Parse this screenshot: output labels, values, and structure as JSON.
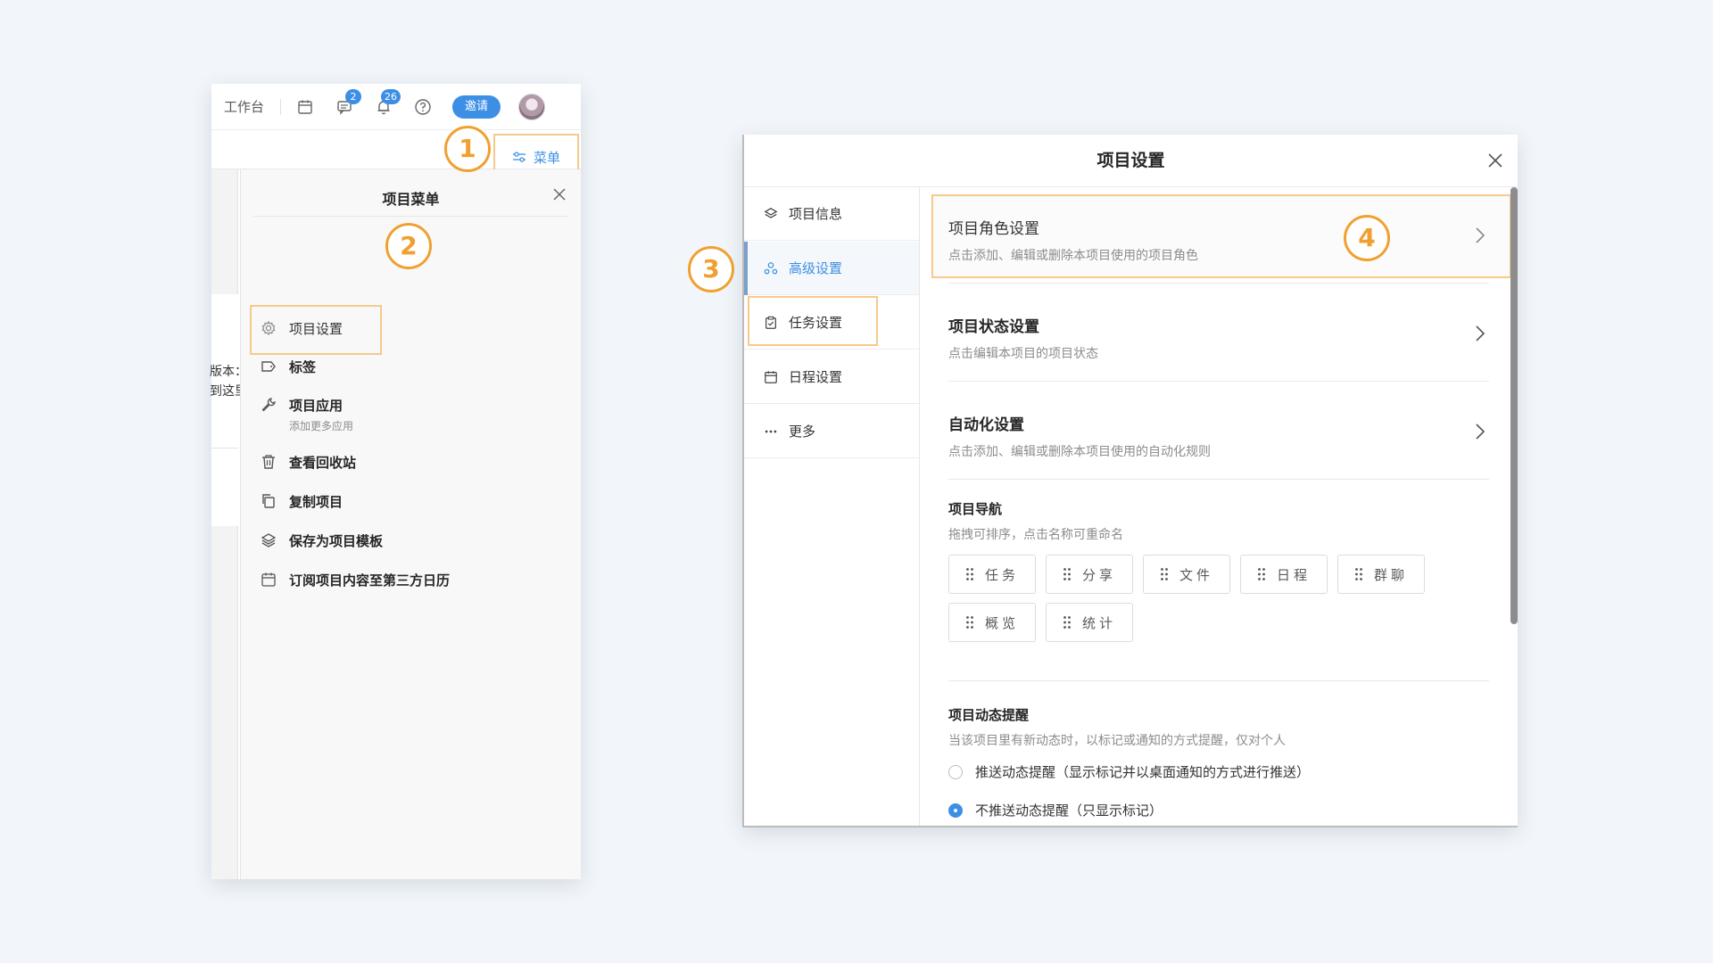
{
  "topbar": {
    "workbench": "工作台",
    "message_badge": "2",
    "notification_badge": "26",
    "invite_label": "邀请"
  },
  "menu_button": {
    "label": "菜单"
  },
  "background_text": {
    "line1": "版本：",
    "line2": "到这里"
  },
  "project_menu": {
    "title": "项目菜单",
    "items": [
      {
        "label": "项目设置",
        "icon": "gear-icon"
      },
      {
        "label": "标签",
        "icon": "tag-icon"
      },
      {
        "label": "项目应用",
        "sub": "添加更多应用",
        "icon": "wrench-icon"
      },
      {
        "label": "查看回收站",
        "icon": "trash-icon"
      },
      {
        "label": "复制项目",
        "icon": "copy-icon"
      },
      {
        "label": "保存为项目模板",
        "icon": "layers-icon"
      },
      {
        "label": "订阅项目内容至第三方日历",
        "icon": "calendar-icon"
      }
    ]
  },
  "steps": [
    "1",
    "2",
    "3",
    "4"
  ],
  "dialog": {
    "title": "项目设置",
    "sidebar": [
      {
        "label": "项目信息",
        "icon": "layers-icon"
      },
      {
        "label": "高级设置",
        "icon": "people-icon",
        "active": true
      },
      {
        "label": "任务设置",
        "icon": "clipboard-icon"
      },
      {
        "label": "日程设置",
        "icon": "calendar-icon"
      },
      {
        "label": "更多",
        "icon": "more-icon"
      }
    ],
    "settings": [
      {
        "title": "项目角色设置",
        "desc": "点击添加、编辑或删除本项目使用的项目角色"
      },
      {
        "title": "项目状态设置",
        "desc": "点击编辑本项目的项目状态"
      },
      {
        "title": "自动化设置",
        "desc": "点击添加、编辑或删除本项目使用的自动化规则"
      }
    ],
    "navigation": {
      "title": "项目导航",
      "desc": "拖拽可排序，点击名称可重命名",
      "chips": [
        "任务",
        "分享",
        "文件",
        "日程",
        "群聊",
        "概览",
        "统计"
      ]
    },
    "notify": {
      "title": "项目动态提醒",
      "desc": "当该项目里有新动态时，以标记或通知的方式提醒，仅对个人",
      "options": [
        {
          "label": "推送动态提醒（显示标记并以桌面通知的方式进行推送）",
          "selected": false
        },
        {
          "label": "不推送动态提醒（只显示标记）",
          "selected": true
        }
      ]
    }
  },
  "colors": {
    "accent": "#3d8fe6",
    "highlight": "#f6c98d",
    "step": "#f0a030"
  }
}
